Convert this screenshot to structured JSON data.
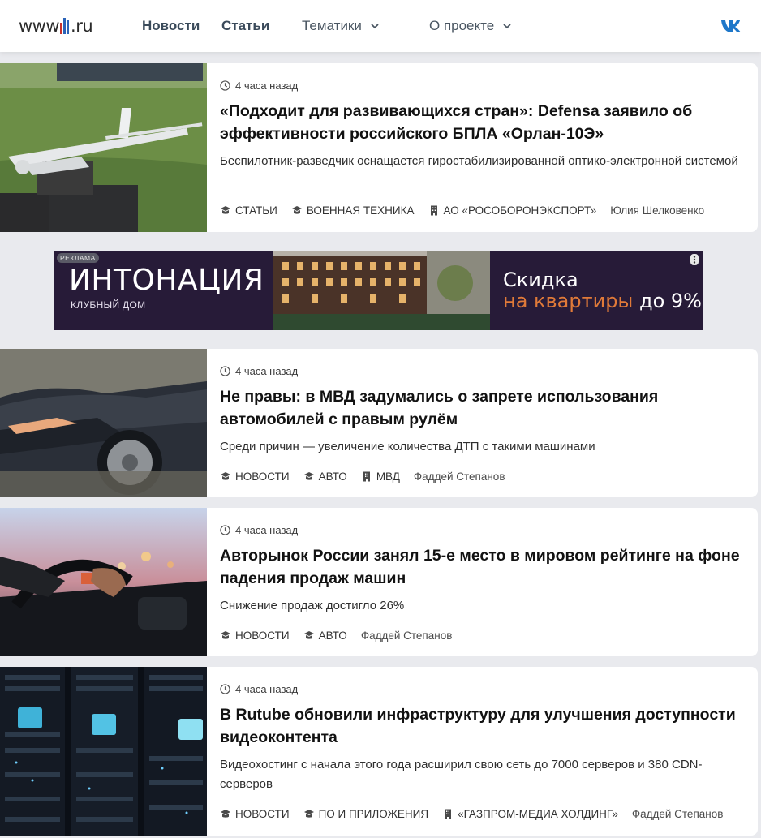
{
  "header": {
    "logo_prefix": "www",
    "logo_suffix": ".ru",
    "nav": {
      "news": "Новости",
      "articles": "Статьи",
      "topics": "Тематики",
      "about": "О проекте"
    }
  },
  "ad": {
    "label": "РЕКЛАМА",
    "brand": "ИНТОНАЦИЯ",
    "subtitle": "КЛУБНЫЙ ДОМ",
    "promo_line1": "Скидка",
    "promo_accent": "на квартиры",
    "promo_rest": " до 9%"
  },
  "articles": [
    {
      "time": "4 часа назад",
      "title": "«Подходит для развивающихся стран»: Defensa заявило об эффективности российского БПЛА «Орлан-10Э»",
      "lead": "Беспилотник-разведчик оснащается гиростабилизированной оптико-электронной системой",
      "tags": [
        "СТАТЬИ",
        "ВОЕННАЯ ТЕХНИКА"
      ],
      "org": "АО «РОСОБОРОНЭКСПОРТ»",
      "author": "Юлия Шелковенко"
    },
    {
      "time": "4 часа назад",
      "title": "Не правы: в МВД задумались о запрете использования автомобилей с правым рулём",
      "lead": "Среди причин — увеличение количества ДТП с такими машинами",
      "tags": [
        "НОВОСТИ",
        "АВТО"
      ],
      "org": "МВД",
      "author": "Фаддей Степанов"
    },
    {
      "time": "4 часа назад",
      "title": "Авторынок России занял 15-е место в мировом рейтинге на фоне падения продаж машин",
      "lead": "Снижение продаж достигло 26%",
      "tags": [
        "НОВОСТИ",
        "АВТО"
      ],
      "author": "Фаддей Степанов"
    },
    {
      "time": "4 часа назад",
      "title": "В Rutube обновили инфраструктуру для улучшения доступности видеоконтента",
      "lead": "Видеохостинг с начала этого года расширил свою сеть до 7000 серверов и 380 CDN-серверов",
      "tags": [
        "НОВОСТИ",
        "ПО И ПРИЛОЖЕНИЯ"
      ],
      "org": "«ГАЗПРОМ-МЕДИА ХОЛДИНГ»",
      "author": "Фаддей Степанов"
    }
  ]
}
